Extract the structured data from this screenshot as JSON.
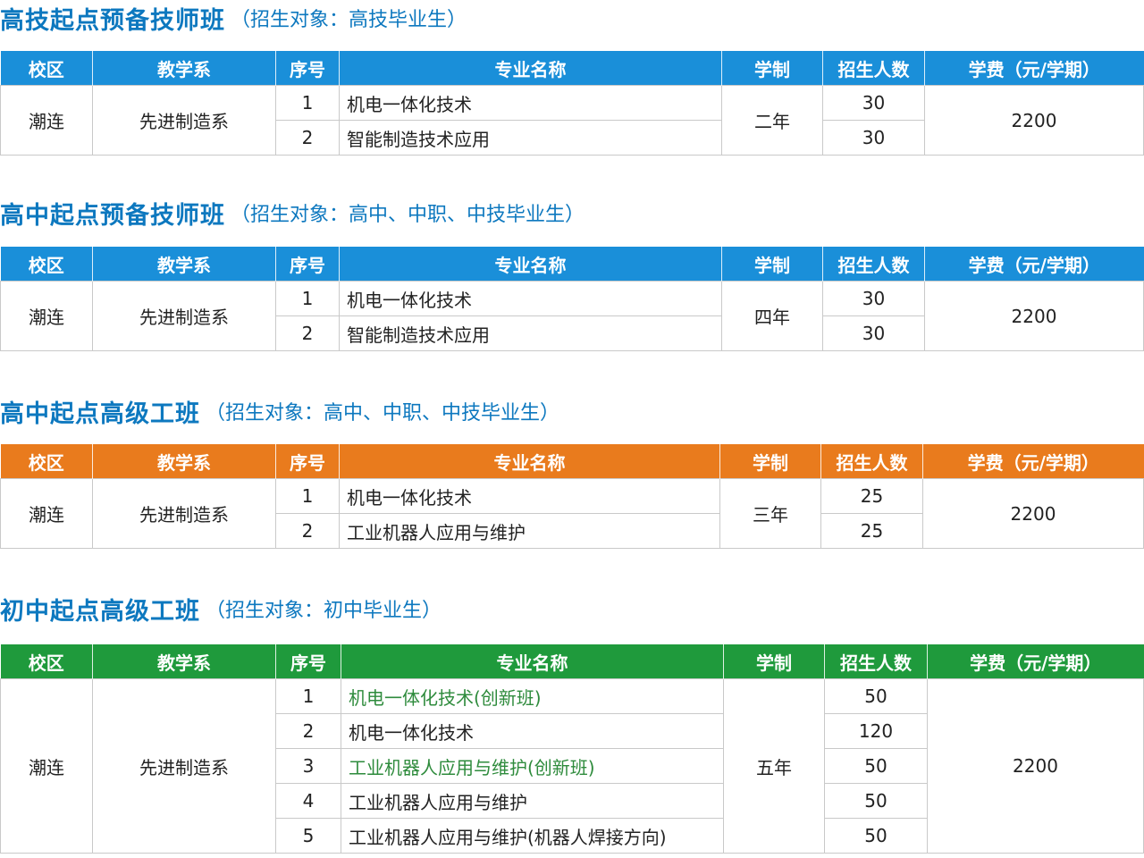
{
  "header_columns": [
    "校区",
    "教学系",
    "序号",
    "专业名称",
    "学制",
    "招生人数",
    "学费（元/学期）"
  ],
  "sections": [
    {
      "title": "高技起点预备技师班",
      "subtitle": "（招生对象：高技毕业生）",
      "header_color": "#1a8fd9",
      "campus": "潮连",
      "department": "先进制造系",
      "duration": "二年",
      "tuition": "2200",
      "rows": [
        {
          "no": "1",
          "major": "机电一体化技术",
          "enroll": "30"
        },
        {
          "no": "2",
          "major": "智能制造技术应用",
          "enroll": "30"
        }
      ]
    },
    {
      "title": "高中起点预备技师班",
      "subtitle": "（招生对象：高中、中职、中技毕业生）",
      "header_color": "#1a8fd9",
      "campus": "潮连",
      "department": "先进制造系",
      "duration": "四年",
      "tuition": "2200",
      "rows": [
        {
          "no": "1",
          "major": "机电一体化技术",
          "enroll": "30"
        },
        {
          "no": "2",
          "major": "智能制造技术应用",
          "enroll": "30"
        }
      ]
    },
    {
      "title": "高中起点高级工班",
      "subtitle": "（招生对象：高中、中职、中技毕业生）",
      "header_color": "#e97b1d",
      "campus": "潮连",
      "department": "先进制造系",
      "duration": "三年",
      "tuition": "2200",
      "rows": [
        {
          "no": "1",
          "major": "机电一体化技术",
          "enroll": "25"
        },
        {
          "no": "2",
          "major": "工业机器人应用与维护",
          "enroll": "25"
        }
      ]
    },
    {
      "title": "初中起点高级工班",
      "subtitle": "（招生对象：初中毕业生）",
      "header_color": "#1f9a3c",
      "campus": "潮连",
      "department": "先进制造系",
      "duration": "五年",
      "tuition": "2200",
      "rows": [
        {
          "no": "1",
          "major": "机电一体化技术(创新班)",
          "enroll": "50",
          "highlight": true
        },
        {
          "no": "2",
          "major": "机电一体化技术",
          "enroll": "120"
        },
        {
          "no": "3",
          "major": "工业机器人应用与维护(创新班)",
          "enroll": "50",
          "highlight": true
        },
        {
          "no": "4",
          "major": "工业机器人应用与维护",
          "enroll": "50"
        },
        {
          "no": "5",
          "major": "工业机器人应用与维护(机器人焊接方向)",
          "enroll": "50"
        }
      ]
    }
  ]
}
